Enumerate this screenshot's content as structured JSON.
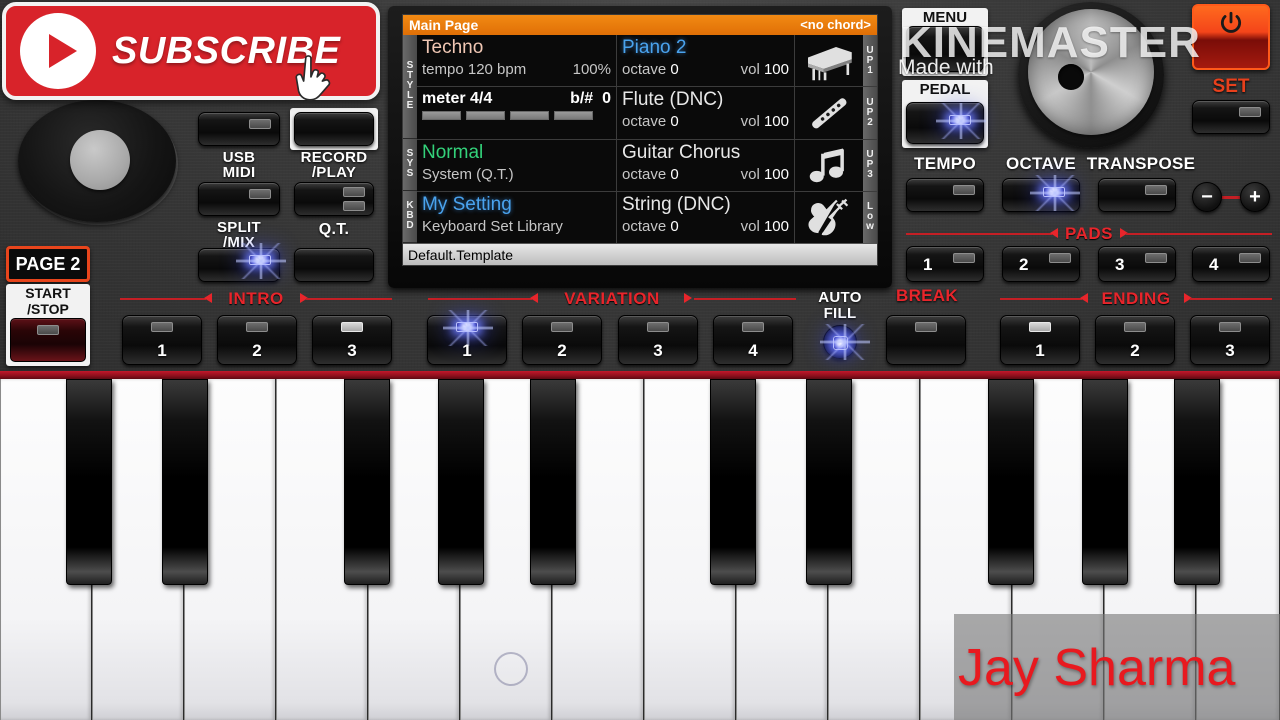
{
  "display": {
    "title": "Main Page",
    "chord": "<no chord>",
    "footer": "Default.Template",
    "side_labels_left": [
      "STYLE",
      "SYS",
      "KBD"
    ],
    "side_labels_right": [
      "UP1",
      "UP2",
      "UP3",
      "Low"
    ],
    "rows": [
      {
        "left_name": "Techno",
        "left_sub_a": "tempo 120 bpm",
        "left_sub_b": "100%",
        "part_name": "Piano 2",
        "octave_label": "octave",
        "octave_value": "0",
        "vol_label": "vol",
        "vol_value": "100",
        "icon": "grand-piano-icon",
        "slot": "UP1"
      },
      {
        "left_name": "meter 4/4",
        "left_sub_a": "b/#",
        "left_sub_b": "0",
        "part_name": "Flute (DNC)",
        "octave_label": "octave",
        "octave_value": "0",
        "vol_label": "vol",
        "vol_value": "100",
        "icon": "flute-icon",
        "slot": "UP2"
      },
      {
        "left_name": "Normal",
        "left_sub_a": "System (Q.T.)",
        "left_sub_b": "",
        "part_name": "Guitar Chorus",
        "octave_label": "octave",
        "octave_value": "0",
        "vol_label": "vol",
        "vol_value": "100",
        "icon": "music-note-icon",
        "slot": "UP3"
      },
      {
        "left_name": "My Setting",
        "left_sub_a": "Keyboard Set Library",
        "left_sub_b": "",
        "part_name": "String (DNC)",
        "octave_label": "octave",
        "octave_value": "0",
        "vol_label": "vol",
        "vol_value": "100",
        "icon": "violin-icon",
        "slot": "Low"
      }
    ]
  },
  "left_panel": {
    "usb_midi_label": "USB\nMIDI",
    "usb_midi_label_l1": "USB",
    "usb_midi_label_l2": "MIDI",
    "record_play_l1": "RECORD",
    "record_play_l2": "/PLAY",
    "split_mix_l1": "SPLIT",
    "split_mix_l2": "/MIX",
    "qt_label": "Q.T.",
    "page2_label": "PAGE 2",
    "start_stop_l1": "START",
    "start_stop_l2": "/STOP"
  },
  "right_panel": {
    "menu_label": "MENU",
    "pedal_label": "PEDAL",
    "tempo_label": "TEMPO",
    "octave_label": "OCTAVE",
    "transpose_label": "TRANSPOSE",
    "set_label": "SET",
    "minus_label": "−",
    "plus_label": "+",
    "power_icon": "power-icon"
  },
  "sections": {
    "pads": {
      "label": "PADS",
      "buttons": [
        "1",
        "2",
        "3",
        "4"
      ]
    },
    "intro": {
      "label": "INTRO",
      "buttons": [
        "1",
        "2",
        "3"
      ]
    },
    "variation": {
      "label": "VARIATION",
      "buttons": [
        "1",
        "2",
        "3",
        "4"
      ]
    },
    "autofill": {
      "label_l1": "AUTO",
      "label_l2": "FILL"
    },
    "break": {
      "label": "BREAK"
    },
    "ending": {
      "label": "ENDING",
      "buttons": [
        "1",
        "2",
        "3"
      ]
    }
  },
  "overlays": {
    "subscribe_text": "SUBSCRIBE",
    "subscribe_icon": "play-icon",
    "cursor_icon": "hand-pointer-icon",
    "kinemaster_text": "KINEMASTER",
    "made_with_text": "Made with",
    "author_watermark": "Jay Sharma"
  },
  "colors": {
    "accent_red": "#e8252b",
    "panel_dark": "#2e2e2e",
    "lcd_orange": "#e06f06",
    "lcd_blue": "#4aa3ee",
    "lcd_green": "#33d17a",
    "subscribe_red": "#d8232a",
    "watermark_red": "#e8191f"
  }
}
